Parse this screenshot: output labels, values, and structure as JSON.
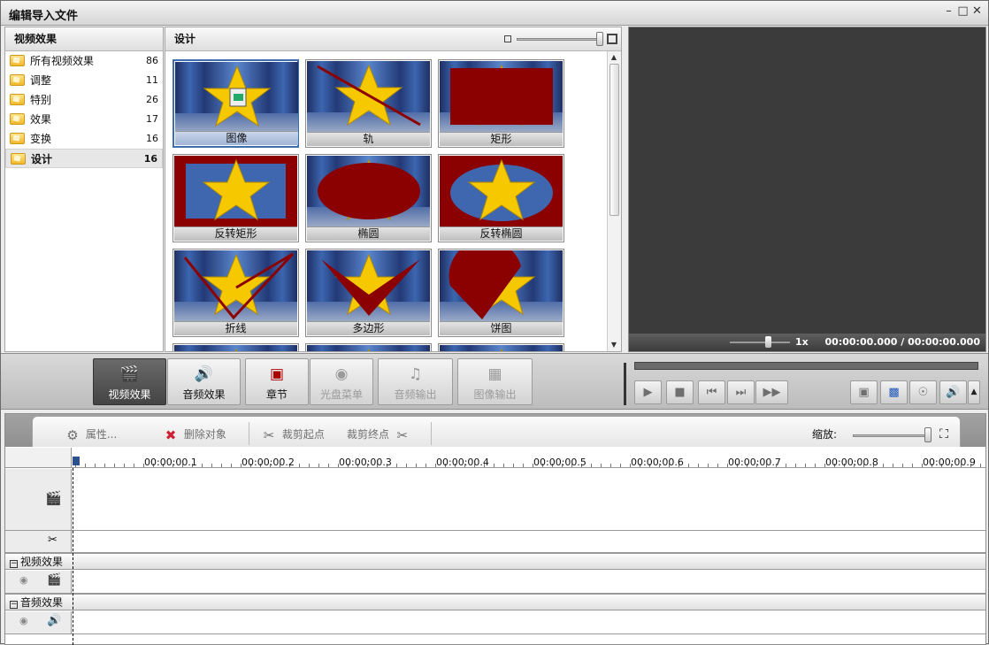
{
  "window": {
    "title": "编辑导入文件",
    "controls": [
      "minimize",
      "maximize",
      "close"
    ]
  },
  "left_panel": {
    "header": "视频效果",
    "categories": [
      {
        "label": "所有视频效果",
        "count": "86"
      },
      {
        "label": "调整",
        "count": "11"
      },
      {
        "label": "特别",
        "count": "26"
      },
      {
        "label": "效果",
        "count": "17"
      },
      {
        "label": "变换",
        "count": "16"
      },
      {
        "label": "设计",
        "count": "16",
        "selected": true
      }
    ]
  },
  "grid_panel": {
    "header": "设计",
    "tiles": [
      {
        "label": "图像",
        "shape": "image",
        "selected": true
      },
      {
        "label": "轨",
        "shape": "track"
      },
      {
        "label": "矩形",
        "shape": "rect"
      },
      {
        "label": "反转矩形",
        "shape": "inv-rect"
      },
      {
        "label": "椭圆",
        "shape": "ellipse"
      },
      {
        "label": "反转椭圆",
        "shape": "inv-ellipse"
      },
      {
        "label": "折线",
        "shape": "polyline"
      },
      {
        "label": "多边形",
        "shape": "polygon"
      },
      {
        "label": "饼图",
        "shape": "pie"
      }
    ],
    "accent_red": "#8b0000"
  },
  "preview": {
    "speed": "1x",
    "current_time": "00:00:00.000",
    "separator": "/",
    "total_time": "00:00:00.000"
  },
  "toolbar": {
    "buttons": [
      {
        "label": "视频效果",
        "icon": "video-effects-icon",
        "active": true
      },
      {
        "label": "音频效果",
        "icon": "audio-effects-icon"
      },
      {
        "label": "章节",
        "icon": "chapter-icon"
      },
      {
        "label": "光盘菜单",
        "icon": "disc-menu-icon",
        "disabled": true
      },
      {
        "label": "音频输出",
        "icon": "audio-output-icon",
        "disabled": true
      },
      {
        "label": "图像输出",
        "icon": "image-output-icon",
        "disabled": true
      }
    ],
    "playback": [
      "play-icon",
      "stop-icon",
      "prev-frame-icon",
      "next-frame-icon",
      "loop-icon"
    ],
    "right": [
      "export-icon",
      "fullscreen-icon",
      "snapshot-icon",
      "volume-icon",
      "dropdown-icon"
    ]
  },
  "timeline": {
    "actions": {
      "properties": "属性...",
      "delete": "删除对象",
      "cut_start": "裁剪起点",
      "cut_end": "裁剪终点"
    },
    "zoom_label": "缩放:",
    "ruler_ticks": [
      "00:00:00.1",
      "00:00:00.2",
      "00:00:00.3",
      "00:00:00.4",
      "00:00:00.5",
      "00:00:00.6",
      "00:00:00.7",
      "00:00:00.8",
      "00:00:00.9"
    ],
    "groups": {
      "video_effects": "视频效果",
      "audio_effects": "音频效果"
    }
  }
}
